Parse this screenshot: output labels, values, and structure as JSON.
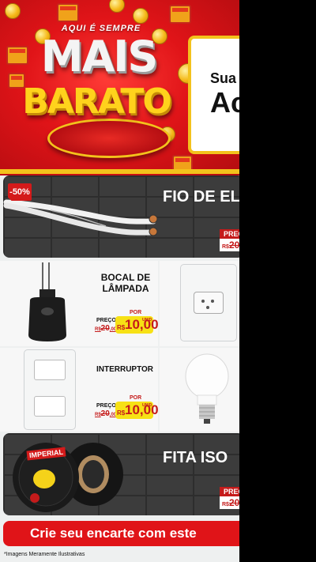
{
  "hero": {
    "arc_text": "AQUI É SEMPRE",
    "headline_1": "MAIS",
    "headline_2": "BARATO",
    "card_line_1": "Sua",
    "card_line_2": "Ac"
  },
  "banners": [
    {
      "title": "FIO DE EL",
      "badge": "-50%",
      "preco_label": "PREÇ",
      "old_price": "20"
    },
    {
      "title": "FITA ISO",
      "preco_label": "PREÇ",
      "old_price": "20"
    }
  ],
  "products": [
    {
      "label": "BOCAL DE LÂMPADA",
      "por": "POR",
      "preco": "PREÇO",
      "old_currency": "R$",
      "old_price": "20",
      "old_cents": ",00",
      "currency": "R$",
      "price": "10,00",
      "unit": "UNID"
    },
    {
      "label": "INTERRUPTOR",
      "por": "POR",
      "preco": "PREÇO",
      "old_currency": "R$",
      "old_price": "20",
      "old_cents": ",00",
      "currency": "R$",
      "price": "10,00",
      "unit": "UNID"
    }
  ],
  "tape_brand": "IMPERIAL",
  "cta": "Crie seu encarte com este",
  "disclaimer": "*Imagens Meramente Ilustrativas",
  "colors": {
    "brand_red": "#e01418",
    "accent_yellow": "#f3c21c",
    "price_yellow": "#f7e115"
  }
}
